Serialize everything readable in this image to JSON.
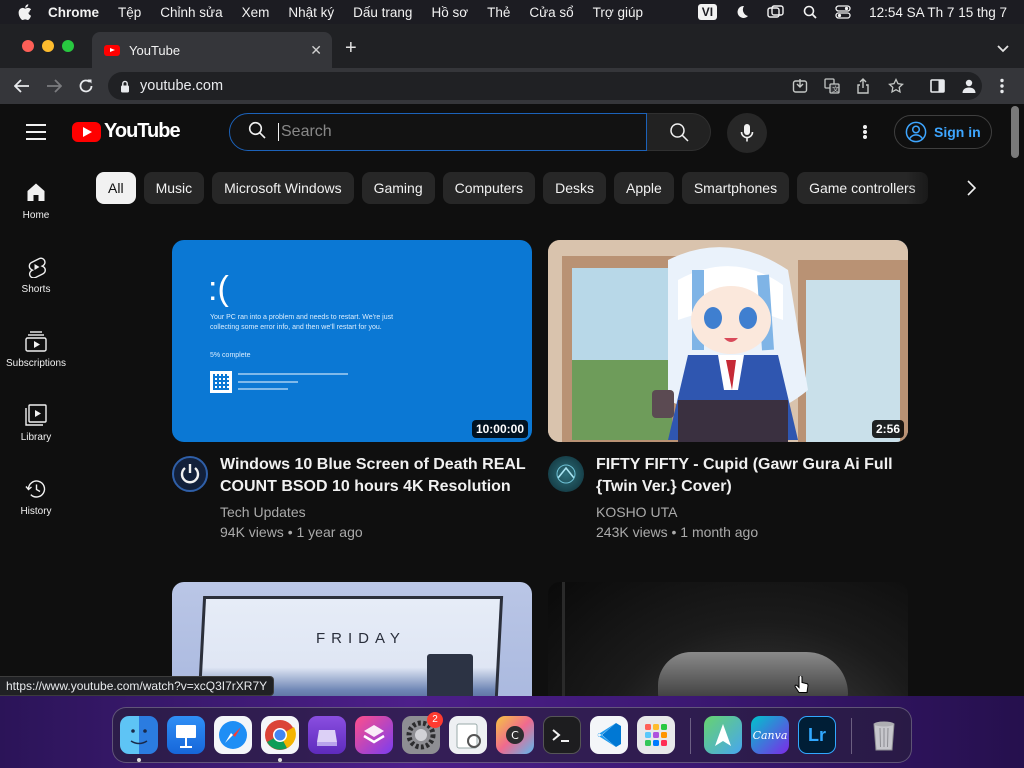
{
  "menubar": {
    "app_name": "Chrome",
    "items": [
      "Tệp",
      "Chỉnh sửa",
      "Xem",
      "Nhật ký",
      "Dấu trang",
      "Hồ sơ",
      "Thẻ",
      "Cửa sổ",
      "Trợ giúp"
    ],
    "input_source": "VI",
    "clock": "12:54 SA Th 7 15 thg 7"
  },
  "tab": {
    "title": "YouTube"
  },
  "toolbar": {
    "url": "youtube.com"
  },
  "youtube": {
    "logo_text": "YouTube",
    "search_placeholder": "Search",
    "signin_label": "Sign in",
    "guide": [
      {
        "label": "Home",
        "icon": "home-icon"
      },
      {
        "label": "Shorts",
        "icon": "shorts-icon"
      },
      {
        "label": "Subscriptions",
        "icon": "subscriptions-icon"
      },
      {
        "label": "Library",
        "icon": "library-icon"
      },
      {
        "label": "History",
        "icon": "history-icon"
      }
    ],
    "chips": [
      "All",
      "Music",
      "Microsoft Windows",
      "Gaming",
      "Computers",
      "Desks",
      "Apple",
      "Smartphones",
      "Game controllers"
    ],
    "videos": [
      {
        "title": "Windows 10 Blue Screen of Death REAL COUNT BSOD 10 hours 4K Resolution",
        "channel": "Tech Updates",
        "stats": "94K views • 1 year ago",
        "duration": "10:00:00",
        "thumb_text": {
          "face": ":(",
          "line1": "Your PC ran into a problem and needs to restart. We're just collecting some error info, and then we'll restart for you.",
          "progress": "5% complete"
        }
      },
      {
        "title": "FIFTY FIFTY - Cupid (Gawr Gura Ai Full {Twin Ver.} Cover)",
        "channel": "KOSHO UTA",
        "stats": "243K views • 1 month ago",
        "duration": "2:56"
      },
      {
        "thumb_text": {
          "word": "FRIDAY"
        }
      },
      {}
    ]
  },
  "status_url": "https://www.youtube.com/watch?v=xcQ3I7rXR7Y",
  "dock": {
    "settings_badge": "2",
    "lightroom_label": "Lr",
    "canva_label": "Canva"
  },
  "colors": {
    "background": "#0f0f0f",
    "chip_bg": "#272727",
    "accent_blue": "#3ea6ff",
    "youtube_red": "#ff0000",
    "bsod_blue": "#0b78d4"
  }
}
